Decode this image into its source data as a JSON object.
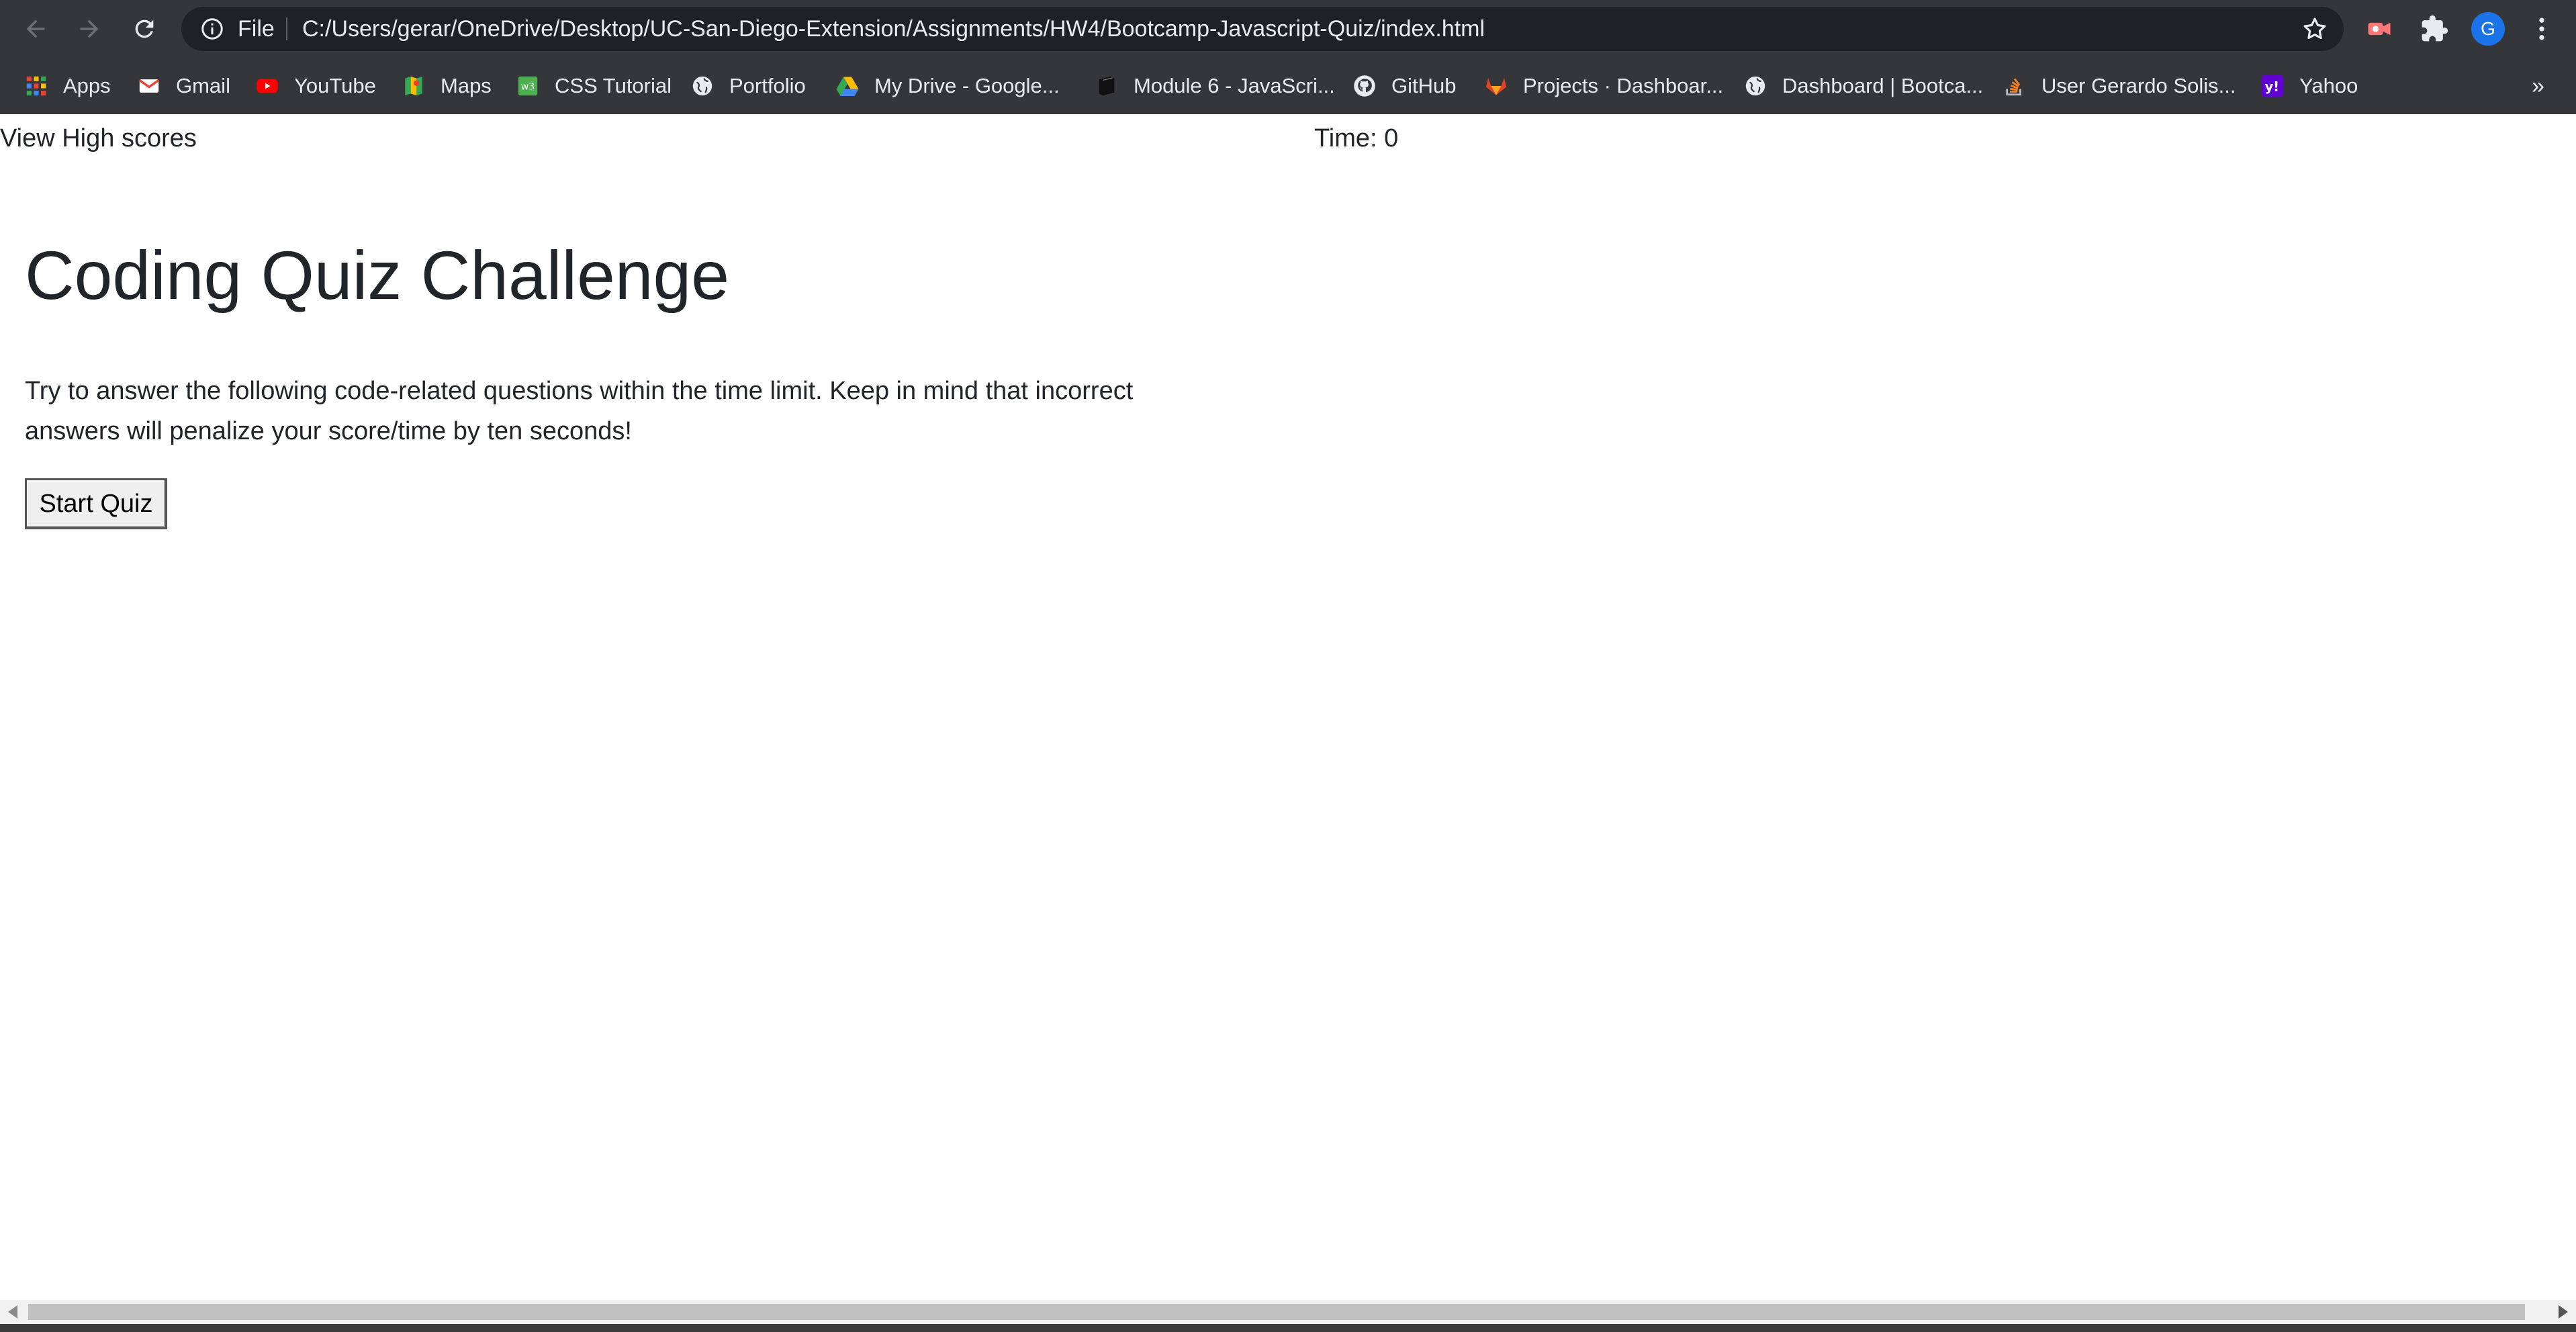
{
  "browser": {
    "scheme_label": "File",
    "url": "C:/Users/gerar/OneDrive/Desktop/UC-San-Diego-Extension/Assignments/HW4/Bootcamp-Javascript-Quiz/index.html",
    "profile_initial": "G",
    "bookmarks": [
      {
        "label": "Apps",
        "icon": "apps-grid-icon"
      },
      {
        "label": "Gmail",
        "icon": "gmail-icon"
      },
      {
        "label": "YouTube",
        "icon": "youtube-icon"
      },
      {
        "label": "Maps",
        "icon": "maps-icon"
      },
      {
        "label": "CSS Tutorial",
        "icon": "css-tutorial-icon"
      },
      {
        "label": "Portfolio",
        "icon": "globe-icon"
      },
      {
        "label": "My Drive - Google...",
        "icon": "google-drive-icon"
      },
      {
        "label": "Module 6 - JavaScri...",
        "icon": "book-icon"
      },
      {
        "label": "GitHub",
        "icon": "github-icon"
      },
      {
        "label": "Projects · Dashboar...",
        "icon": "gitlab-icon"
      },
      {
        "label": "Dashboard | Bootca...",
        "icon": "globe-icon"
      },
      {
        "label": "User Gerardo Solis...",
        "icon": "stackoverflow-icon"
      },
      {
        "label": "Yahoo",
        "icon": "yahoo-icon"
      }
    ],
    "more_bookmarks": "»"
  },
  "page": {
    "highscores_link": "View High scores",
    "timer": "Time: 0",
    "title": "Coding Quiz Challenge",
    "intro": "Try to answer the following code-related questions within the time limit. Keep in mind that incorrect answers will penalize your score/time by ten seconds!",
    "start_button": "Start Quiz"
  },
  "colors": {
    "chrome_bg": "#35363a",
    "omnibox_bg": "#202124",
    "chrome_text": "#e8eaed",
    "page_text": "#212529",
    "avatar_bg": "#1a73e8"
  }
}
